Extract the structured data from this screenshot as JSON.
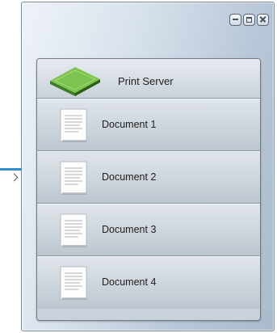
{
  "window": {
    "controls": {
      "minimize_icon": "minimize-icon",
      "maximize_icon": "maximize-icon",
      "close_icon": "close-icon"
    }
  },
  "queue": {
    "server": {
      "label": "Print Server",
      "icon": "print-server-icon",
      "color": "#5fa43c"
    },
    "documents": [
      {
        "label": "Document 1",
        "icon": "document-icon"
      },
      {
        "label": "Document 2",
        "icon": "document-icon"
      },
      {
        "label": "Document 3",
        "icon": "document-icon"
      },
      {
        "label": "Document 4",
        "icon": "document-icon"
      }
    ]
  },
  "colors": {
    "accent": "#2f8fd0"
  }
}
